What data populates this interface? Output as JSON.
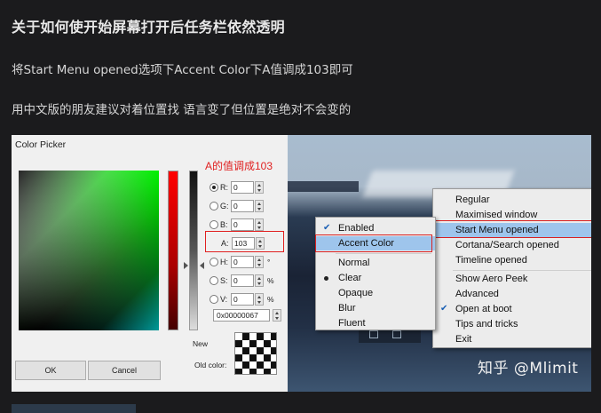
{
  "article": {
    "title": "关于如何使开始屏幕打开后任务栏依然透明",
    "para1": "将Start Menu opened选项下Accent Color下A值调成103即可",
    "para2": "用中文版的朋友建议对着位置找 语言变了但位置是绝对不会变的"
  },
  "color_picker": {
    "title": "Color Picker",
    "annotation": "A的值调成103",
    "fields": [
      {
        "label": "R:",
        "value": "0",
        "unit": "",
        "selected": true
      },
      {
        "label": "G:",
        "value": "0",
        "unit": "",
        "selected": false
      },
      {
        "label": "B:",
        "value": "0",
        "unit": "",
        "selected": false
      },
      {
        "label": "A:",
        "value": "103",
        "unit": "",
        "selected": false
      },
      {
        "label": "H:",
        "value": "0",
        "unit": "°",
        "selected": false
      },
      {
        "label": "S:",
        "value": "0",
        "unit": "%",
        "selected": false
      },
      {
        "label": "V:",
        "value": "0",
        "unit": "%",
        "selected": false
      }
    ],
    "hex": "0x00000067",
    "new_label": "New",
    "old_label": "Old color:",
    "ok": "OK",
    "cancel": "Cancel"
  },
  "left_menu": {
    "items": [
      {
        "label": "Enabled",
        "mark": "check"
      },
      {
        "label": "Accent Color",
        "mark": "",
        "selected": true
      },
      {
        "label": "Normal",
        "mark": ""
      },
      {
        "label": "Clear",
        "mark": "dot"
      },
      {
        "label": "Opaque",
        "mark": ""
      },
      {
        "label": "Blur",
        "mark": ""
      },
      {
        "label": "Fluent",
        "mark": ""
      }
    ]
  },
  "right_menu": {
    "items": [
      {
        "label": "Regular",
        "sub": true
      },
      {
        "label": "Maximised window",
        "sub": true
      },
      {
        "label": "Start Menu opened",
        "sub": true,
        "selected": true
      },
      {
        "label": "Cortana/Search opened",
        "sub": true
      },
      {
        "label": "Timeline opened",
        "sub": true
      },
      {
        "label": "Show Aero Peek",
        "sub": true
      },
      {
        "label": "Advanced",
        "sub": true
      },
      {
        "label": "Open at boot",
        "sub": false,
        "mark": "check"
      },
      {
        "label": "Tips and tricks",
        "sub": true
      },
      {
        "label": "Exit",
        "sub": false
      }
    ]
  },
  "watermark": "知乎 @Mlimit"
}
